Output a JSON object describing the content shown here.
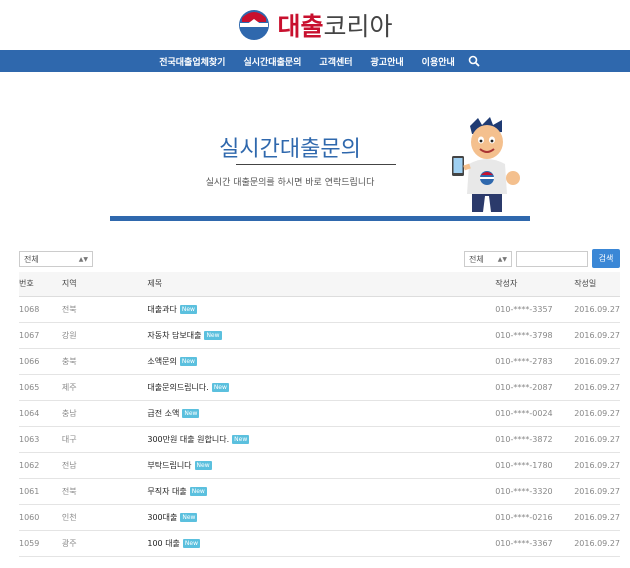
{
  "logo": {
    "strong": "대출",
    "light": "코리아"
  },
  "nav": {
    "items": [
      "전국대출업체찾기",
      "실시간대출문의",
      "고객센터",
      "광고안내",
      "이용안내"
    ]
  },
  "hero": {
    "title": "실시간대출문의",
    "subtitle": "실시간 대출문의를 하시면 바로 연락드립니다"
  },
  "filters": {
    "left_select": "전체",
    "right_select": "전체",
    "search_placeholder": "",
    "search_button": "검색"
  },
  "table": {
    "headers": {
      "no": "번호",
      "region": "지역",
      "title": "제목",
      "writer": "작성자",
      "date": "작성일"
    },
    "badge": "New",
    "rows": [
      {
        "no": "1068",
        "region": "전북",
        "title": "대출과다",
        "writer": "010-****-3357",
        "date": "2016.09.27"
      },
      {
        "no": "1067",
        "region": "강원",
        "title": "자동차 담보대출",
        "writer": "010-****-3798",
        "date": "2016.09.27"
      },
      {
        "no": "1066",
        "region": "충북",
        "title": "소액문의",
        "writer": "010-****-2783",
        "date": "2016.09.27"
      },
      {
        "no": "1065",
        "region": "제주",
        "title": "대출문의드립니다.",
        "writer": "010-****-2087",
        "date": "2016.09.27"
      },
      {
        "no": "1064",
        "region": "충남",
        "title": "급전 소액",
        "writer": "010-****-0024",
        "date": "2016.09.27"
      },
      {
        "no": "1063",
        "region": "대구",
        "title": "300만원 대출 원합니다.",
        "writer": "010-****-3872",
        "date": "2016.09.27"
      },
      {
        "no": "1062",
        "region": "전남",
        "title": "부탁드립니다",
        "writer": "010-****-1780",
        "date": "2016.09.27"
      },
      {
        "no": "1061",
        "region": "전북",
        "title": "무직자 대출",
        "writer": "010-****-3320",
        "date": "2016.09.27"
      },
      {
        "no": "1060",
        "region": "인천",
        "title": "300대출",
        "writer": "010-****-0216",
        "date": "2016.09.27"
      },
      {
        "no": "1059",
        "region": "광주",
        "title": "100 대출",
        "writer": "010-****-3367",
        "date": "2016.09.27"
      }
    ]
  },
  "colors": {
    "brand_blue": "#2f68ad",
    "brand_red": "#c8102e",
    "button_blue": "#3a87d6",
    "badge": "#5bc0de"
  }
}
